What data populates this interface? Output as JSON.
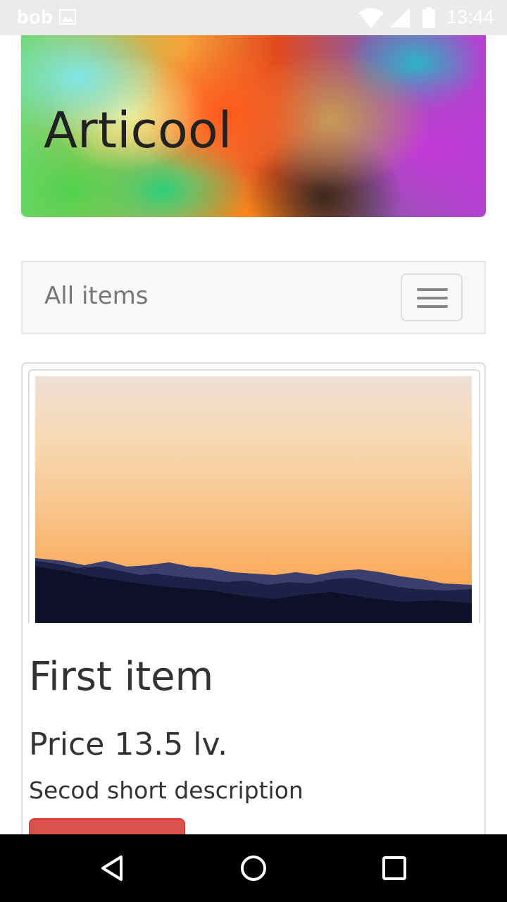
{
  "status_bar": {
    "owner": "bob",
    "time": "13:44",
    "icons": [
      "image-icon",
      "wifi-icon",
      "signal-icon",
      "battery-icon"
    ]
  },
  "header": {
    "title": "Articool"
  },
  "navbar": {
    "brand": "All items",
    "toggle_icon": "hamburger-menu-icon"
  },
  "items": [
    {
      "title": "First item",
      "price": "Price 13.5 lv.",
      "description": "Secod short description",
      "button_label": ""
    }
  ],
  "system_nav": {
    "buttons": [
      "back-icon",
      "home-icon",
      "recents-icon"
    ]
  },
  "colors": {
    "status_bar_bg": "#ebebeb",
    "navbar_bg": "#f8f8f8",
    "danger_button": "#d9534f",
    "system_nav_bg": "#000000"
  }
}
